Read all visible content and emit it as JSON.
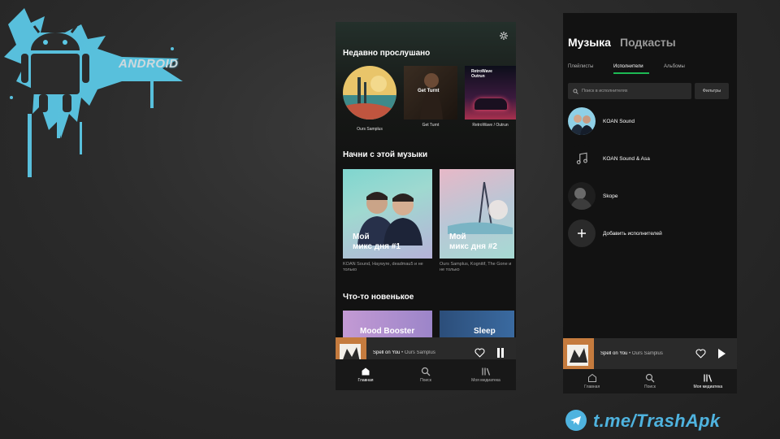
{
  "branding": {
    "android_text": "ANDROID",
    "telegram_link": "t.me/TrashApk"
  },
  "home": {
    "section_recent": "Недавно прослушано",
    "recent": [
      {
        "title": "Ours Samplus"
      },
      {
        "title": "Get Turnt"
      },
      {
        "title": "RetroWave / Outrun"
      }
    ],
    "get_turnt_cover_text": "Get Turnt",
    "retrowave_cover_text_1": "RetroWave",
    "retrowave_cover_text_2": "Outrun",
    "section_start": "Начни с этой музыки",
    "mixes": [
      {
        "title": "Мой\nмикс дня #1",
        "desc": "KOAN Sound, Haywyre, deadmau5 и не только"
      },
      {
        "title": "Мой\nмикс дня #2",
        "desc": "Ours Samplus, Kognitif, The Gone и не только"
      }
    ],
    "section_new": "Что-то новенькое",
    "new_cards": [
      {
        "title": "Mood Booster"
      },
      {
        "title": "Sleep"
      }
    ],
    "player": {
      "song": "Spell on You",
      "separator": " • ",
      "artist": "Ours Samplus"
    },
    "nav": [
      {
        "label": "Главная",
        "icon": "home-icon"
      },
      {
        "label": "Поиск",
        "icon": "search-icon"
      },
      {
        "label": "Моя медиатека",
        "icon": "library-icon"
      }
    ]
  },
  "library": {
    "tabs": [
      "Музыка",
      "Подкасты"
    ],
    "subtabs": [
      "Плейлисты",
      "Исполнители",
      "Альбомы"
    ],
    "search_placeholder": "Поиск в исполнителях",
    "filters_label": "Фильтры",
    "artists": [
      {
        "name": "KOAN Sound"
      },
      {
        "name": "KOAN Sound & Asa"
      },
      {
        "name": "Skope"
      }
    ],
    "add_artists": "Добавить исполнителей",
    "player": {
      "song": "Spell on You",
      "separator": " • ",
      "artist": "Ours Samplus"
    },
    "nav": [
      {
        "label": "Главная",
        "icon": "home-icon"
      },
      {
        "label": "Поиск",
        "icon": "search-icon"
      },
      {
        "label": "Моя медиатека",
        "icon": "library-icon"
      }
    ]
  },
  "colors": {
    "accent_green": "#1db954",
    "telegram_blue": "#4fb3df",
    "android_blue": "#5bc8e6"
  }
}
